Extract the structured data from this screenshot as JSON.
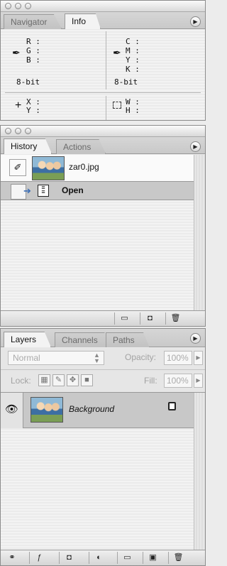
{
  "navigator_info": {
    "tabs": [
      "Navigator",
      "Info"
    ],
    "rgb_labels": [
      "R :",
      "G :",
      "B :"
    ],
    "cmyk_labels": [
      "C :",
      "M :",
      "Y :",
      "K :"
    ],
    "bit_left": "8-bit",
    "bit_right": "8-bit",
    "xy_labels": [
      "X :",
      "Y :"
    ],
    "wh_labels": [
      "W :",
      "H :"
    ]
  },
  "history": {
    "tabs": [
      "History",
      "Actions"
    ],
    "snapshot_name": "zar0.jpg",
    "state_name": "Open"
  },
  "layers": {
    "tabs": [
      "Layers",
      "Channels",
      "Paths"
    ],
    "blend_mode": "Normal",
    "opacity_label": "Opacity:",
    "opacity_value": "100%",
    "lock_label": "Lock:",
    "fill_label": "Fill:",
    "fill_value": "100%",
    "layer_name": "Background"
  },
  "icons": {
    "panel_menu": "panel-menu-icon",
    "eyedropper": "eyedropper-icon",
    "crosshair": "crosshair-icon",
    "selection": "selection-size-icon",
    "history_brush": "history-brush-icon",
    "eye": "eye-icon",
    "lock": "lock-icon",
    "trash": "trash-icon"
  }
}
